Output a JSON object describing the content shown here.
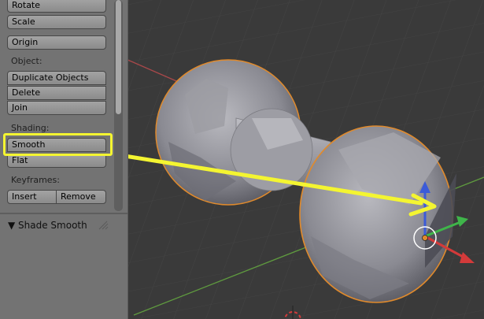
{
  "tools": {
    "buttons": {
      "rotate": "Rotate",
      "scale": "Scale",
      "origin": "Origin",
      "duplicate_objects": "Duplicate Objects",
      "delete": "Delete",
      "join": "Join",
      "smooth": "Smooth",
      "flat": "Flat",
      "insert": "Insert",
      "remove": "Remove"
    },
    "sections": {
      "object": "Object:",
      "shading": "Shading:",
      "keyframes": "Keyframes:"
    }
  },
  "operator_panel": {
    "title": "▼ Shade Smooth"
  },
  "colors": {
    "annotation": "#f4f531",
    "selection_outline": "#e08a2c",
    "grid_x_axis": "#a8484a",
    "grid_y_axis": "#5f9a3f"
  },
  "icons": {
    "arrow": "annotation-arrow",
    "gizmo": "transform-manipulator"
  }
}
